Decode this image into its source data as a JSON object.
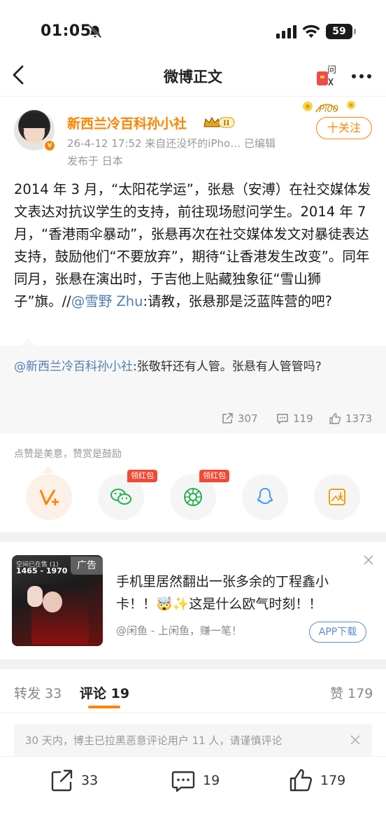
{
  "status_bar": {
    "time": "01:05",
    "battery": "59"
  },
  "nav": {
    "title": "微博正文"
  },
  "author": {
    "name": "新西兰冷百科孙小社",
    "level": "II",
    "verified_badge": "v",
    "meta": "26-4-12 17:52   来自还没坏的iPho…  已编辑",
    "location": "发布于 日本",
    "follow_label": "十关注"
  },
  "post": {
    "text": "2014 年 3 月，“太阳花学运”，张悬（安溥）在社交媒体发文表达对抗议学生的支持，前往现场慰问学生。2014 年 7 月，“香港雨伞暴动”，张悬再次在社交媒体发文对暴徒表达支持，鼓励他们“不要放弃”，期待“让香港发生改变”。同年同月，张悬在演出时，于吉他上贴藏独象征“雪山狮子”旗。",
    "mention_prefix": "//",
    "mention_user": "@雪野 Zhu",
    "mention_text": ":请教，张悬那是泛蓝阵营的吧?"
  },
  "retweet": {
    "mention": "@新西兰冷百科孙小社",
    "text": ":张敬轩还有人管。张悬有人管管吗?",
    "reposts": "307",
    "comments": "119",
    "likes": "1373"
  },
  "reward": {
    "hint": "点赞是美意，赞赏是鼓励",
    "hongbao_tag": "领红包",
    "items": [
      "vplus-icon",
      "wechat-icon",
      "moments-icon",
      "qq-icon",
      "save-image-icon"
    ]
  },
  "ad": {
    "label": "广告",
    "img_top": "空间已在售 (1)",
    "img_num": "1465 - 1970",
    "text": "手机里居然翻出一张多余的丁程鑫小卡！！🤯✨这是什么欧气时刻！！",
    "source": "@闲鱼 - 上闲鱼，赚一笔！",
    "button": "APP下载"
  },
  "tabs": {
    "repost": "转发 33",
    "comment": "评论 19",
    "like": "赞 179"
  },
  "notice": {
    "text": "30 天内，博主已拉黑恶意评论用户 11 人，请谨慎评论"
  },
  "bottom_bar": {
    "reposts": "33",
    "comments": "19",
    "likes": "179"
  },
  "colors": {
    "accent": "#ff8200",
    "link": "#507daf",
    "hongbao": "#f04a36"
  }
}
